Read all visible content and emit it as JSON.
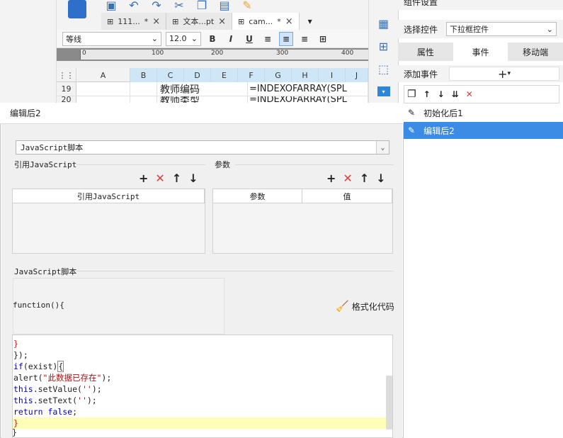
{
  "tabs": [
    {
      "label": "111...",
      "modified": "*",
      "close": "×"
    },
    {
      "label": "文本...pt",
      "modified": "",
      "close": "×"
    },
    {
      "label": "cam...",
      "modified": "*",
      "close": "×"
    }
  ],
  "format_bar": {
    "font": "等线",
    "size": "12.0",
    "bold": "B",
    "italic": "I",
    "underline": "U"
  },
  "ruler": {
    "marks": [
      "0",
      "100",
      "200",
      "300",
      "400"
    ]
  },
  "sheet": {
    "columns": [
      "A",
      "B",
      "C",
      "D",
      "E",
      "F",
      "G",
      "H",
      "I",
      "J"
    ],
    "rows": [
      {
        "num": "19",
        "c": "教师编码",
        "f": "=INDEXOFARRAY(SPL"
      },
      {
        "num": "20",
        "c": "教师类型",
        "f": "=INDEXOFARRAY(SPL"
      }
    ]
  },
  "right_panel": {
    "title": "组件设置",
    "select_label": "选择控件",
    "select_value": "下拉框控件",
    "tabs": [
      "属性",
      "事件",
      "移动端"
    ],
    "active_tab": "事件",
    "add_event_label": "添加事件",
    "events": [
      {
        "label": "初始化后1",
        "selected": false
      },
      {
        "label": "编辑后2",
        "selected": true
      }
    ]
  },
  "dialog": {
    "title": "编辑后2",
    "type_value": "JavaScript脚本",
    "ref_section_label": "引用JavaScript",
    "param_section_label": "参数",
    "ref_table_header": "引用JavaScript",
    "param_table_headers": [
      "参数",
      "值"
    ],
    "script_section_label": "JavaScript脚本",
    "function_header": "function(){",
    "format_code_label": "格式化代码",
    "code_lines": [
      {
        "text": "}",
        "cls": "red"
      },
      {
        "text": "});",
        "cls": ""
      },
      {
        "text": "if(exist){",
        "cls": "if"
      },
      {
        "text": "alert(\"此数据已存在\");",
        "cls": "alert"
      },
      {
        "text": "this.setValue('');",
        "cls": "this"
      },
      {
        "text": "this.setText('');",
        "cls": "this"
      },
      {
        "text": "return false;",
        "cls": "return"
      },
      {
        "text": "}",
        "cls": "red hl"
      }
    ],
    "closing_brace": "}"
  }
}
